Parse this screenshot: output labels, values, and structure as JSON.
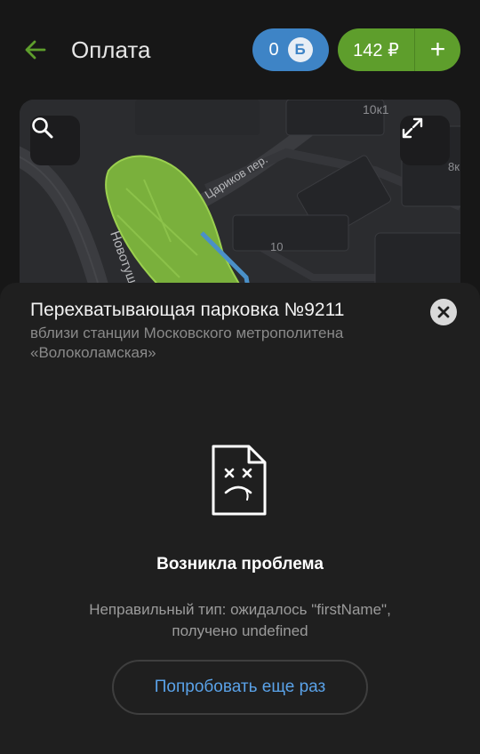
{
  "header": {
    "title": "Оплата",
    "bonus": {
      "value": "0",
      "badge": "Б"
    },
    "balance": {
      "amount": "142 ₽",
      "add_label": "+"
    }
  },
  "map": {
    "labels": {
      "house_10k1": "10к1",
      "street_tsarikov": "Цариков пер.",
      "street_novotush": "Новотуш",
      "house_10": "10",
      "house_8k": "8к"
    }
  },
  "sheet": {
    "parking_title": "Перехватывающая парковка №9211",
    "parking_subtitle": "вблизи станции Московского метрополитена «Волоколамская»",
    "error_title": "Возникла проблема",
    "error_message_line1": "Неправильный тип: ожидалось \"firstName\",",
    "error_message_line2": "получено undefined",
    "retry_label": "Попробовать еще раз"
  },
  "colors": {
    "accent_green": "#5e9e2c",
    "accent_blue": "#3e84c6",
    "link_blue": "#5aa2e8",
    "background": "#171717",
    "sheet": "#1f1f1f"
  },
  "icons": [
    "back-arrow-icon",
    "search-icon",
    "expand-icon",
    "close-icon",
    "sad-document-icon"
  ]
}
